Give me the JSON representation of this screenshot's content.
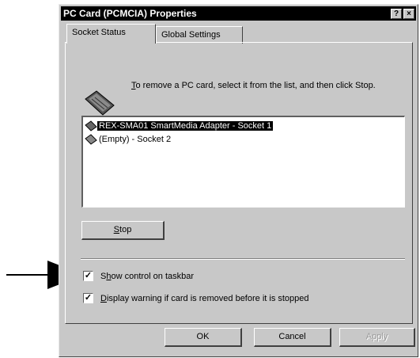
{
  "window": {
    "title": "PC Card (PCMCIA) Properties",
    "help_button": "?",
    "close_button": "×"
  },
  "tabs": [
    {
      "label": "Socket Status",
      "active": true
    },
    {
      "label": "Global Settings",
      "active": false
    }
  ],
  "instructions": {
    "accel": "T",
    "text": "o remove a PC card, select it from the list, and then click Stop."
  },
  "sockets": [
    {
      "label": "REX-SMA01 SmartMedia Adapter - Socket 1",
      "selected": true,
      "icon": "pc-card-icon"
    },
    {
      "label": "(Empty) - Socket 2",
      "selected": false,
      "icon": "empty-slot-icon"
    }
  ],
  "stop_button": {
    "accel": "S",
    "rest": "top"
  },
  "options": {
    "show_control": {
      "pre": "S",
      "accel": "h",
      "rest": "ow control on taskbar",
      "checked": true
    },
    "display_warning": {
      "pre": "",
      "accel": "D",
      "rest": "isplay warning if card is removed before it is stopped",
      "checked": true
    }
  },
  "footer": {
    "ok": "OK",
    "cancel": "Cancel",
    "apply": "Apply"
  },
  "colors": {
    "face": "#c8c8c8",
    "titlebar": "#000000",
    "selection": "#000000"
  }
}
